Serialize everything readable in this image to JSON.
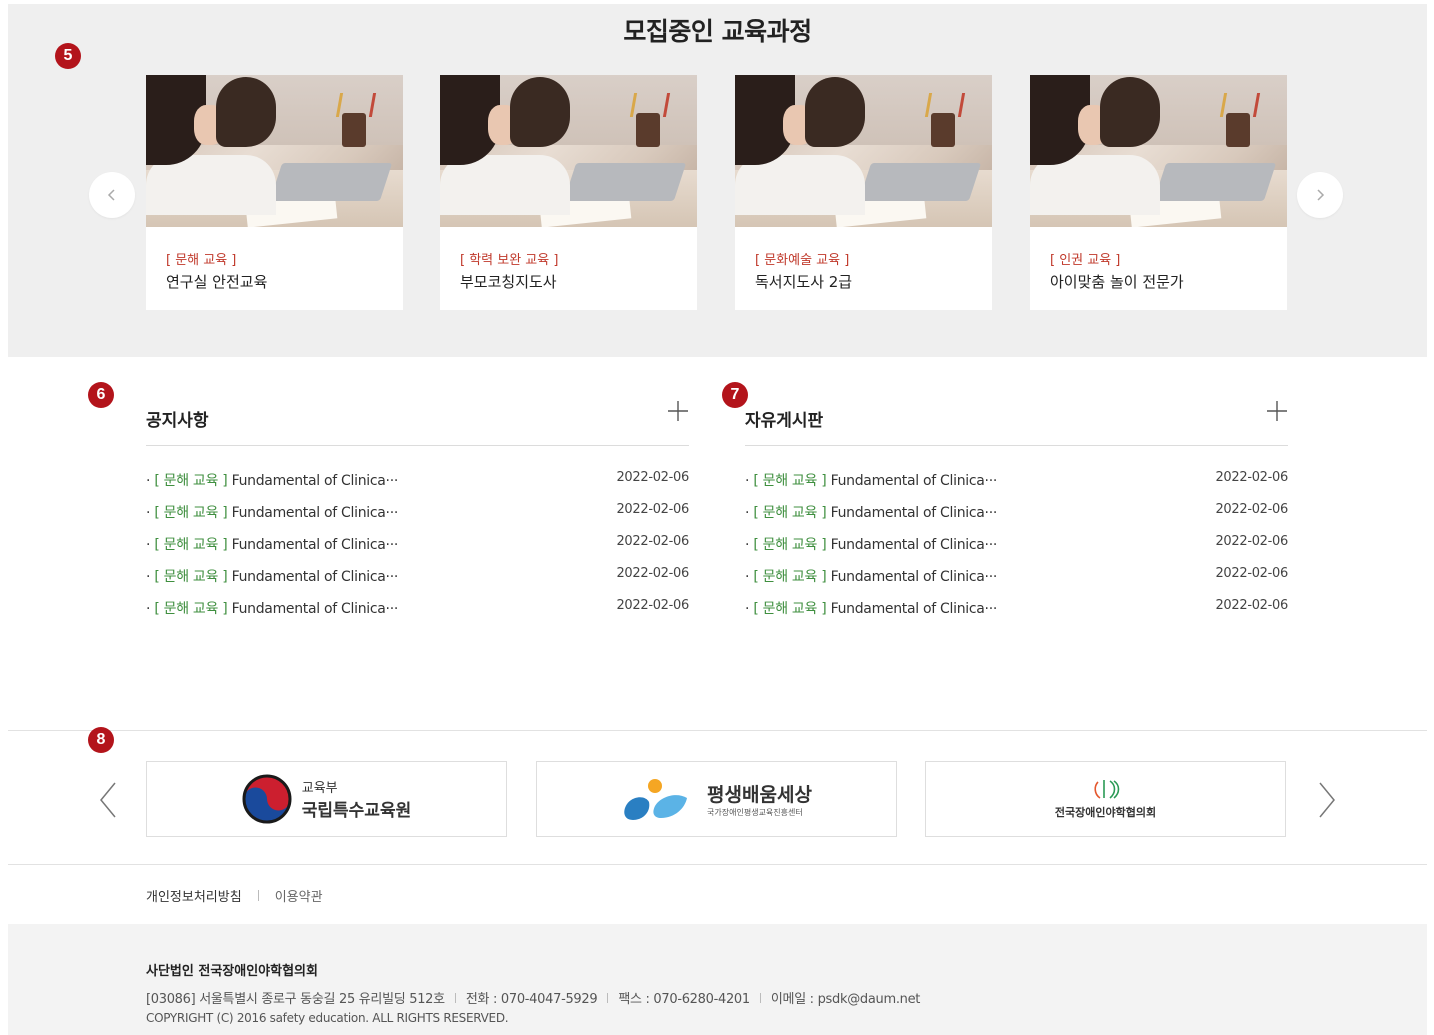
{
  "markers": [
    "5",
    "6",
    "7",
    "8"
  ],
  "courses": {
    "title": "모집중인 교육과정",
    "items": [
      {
        "category": "[ 문해 교육 ]",
        "name": "연구실 안전교육"
      },
      {
        "category": "[ 학력 보완 교육 ]",
        "name": "부모코칭지도사"
      },
      {
        "category": "[ 문화예술 교육 ]",
        "name": "독서지도사 2급"
      },
      {
        "category": "[ 인권 교육 ]",
        "name": "아이맞춤 놀이 전문가"
      }
    ]
  },
  "notice": {
    "title": "공지사항",
    "items": [
      {
        "tag": "[ 문해 교육 ]",
        "text": "Fundamental of Clinica···",
        "date": "2022-02-06"
      },
      {
        "tag": "[ 문해 교육 ]",
        "text": "Fundamental of Clinica···",
        "date": "2022-02-06"
      },
      {
        "tag": "[ 문해 교육 ]",
        "text": "Fundamental of Clinica···",
        "date": "2022-02-06"
      },
      {
        "tag": "[ 문해 교육 ]",
        "text": "Fundamental of Clinica···",
        "date": "2022-02-06"
      },
      {
        "tag": "[ 문해 교육 ]",
        "text": "Fundamental of Clinica···",
        "date": "2022-02-06"
      }
    ]
  },
  "free_board": {
    "title": "자유게시판",
    "items": [
      {
        "tag": "[ 문해 교육 ]",
        "text": "Fundamental of Clinica···",
        "date": "2022-02-06"
      },
      {
        "tag": "[ 문해 교육 ]",
        "text": "Fundamental of Clinica···",
        "date": "2022-02-06"
      },
      {
        "tag": "[ 문해 교육 ]",
        "text": "Fundamental of Clinica···",
        "date": "2022-02-06"
      },
      {
        "tag": "[ 문해 교육 ]",
        "text": "Fundamental of Clinica···",
        "date": "2022-02-06"
      },
      {
        "tag": "[ 문해 교육 ]",
        "text": "Fundamental of Clinica···",
        "date": "2022-02-06"
      }
    ]
  },
  "partners": {
    "p1": {
      "small": "교육부",
      "big": "국립특수교육원"
    },
    "p2": {
      "big": "평생배움세상",
      "small": "국가장애인평생교육진흥센터"
    },
    "p3": {
      "big": "전국장애인야학협의회"
    }
  },
  "links": {
    "privacy": "개인정보처리방침",
    "terms": "이용약관"
  },
  "footer": {
    "org": "사단법인 전국장애인야학협의회",
    "address": "[03086] 서울특별시 종로구 동숭길 25 유리빌딩 512호",
    "phone": "전화 : 070-4047-5929",
    "fax": "팩스 : 070-6280-4201",
    "email": "이메일 : psdk@daum.net",
    "copyright": "COPYRIGHT (C) 2016 safety education. ALL RIGHTS RESERVED."
  },
  "colors": {
    "accent": "#b3141b",
    "category": "#c0392b",
    "tag": "#3f8f3f"
  }
}
